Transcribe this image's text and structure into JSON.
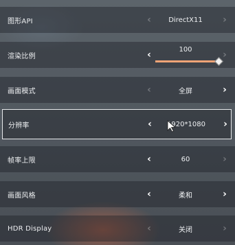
{
  "settings": [
    {
      "label": "图形API",
      "value": "DirectX11",
      "left_enabled": false,
      "right_enabled": false
    },
    {
      "label": "渲染比例",
      "value": "100",
      "left_enabled": true,
      "right_enabled": false,
      "slider_fraction": 1.0
    },
    {
      "label": "画面模式",
      "value": "全屏",
      "left_enabled": false,
      "right_enabled": true
    },
    {
      "label": "分辨率",
      "value": "1920*1080",
      "left_enabled": true,
      "right_enabled": true,
      "selected": true
    },
    {
      "label": "帧率上限",
      "value": "60",
      "left_enabled": true,
      "right_enabled": false
    },
    {
      "label": "画面风格",
      "value": "柔和",
      "left_enabled": true,
      "right_enabled": true
    },
    {
      "label": "HDR Display",
      "value": "关闭",
      "left_enabled": false,
      "right_enabled": false
    }
  ],
  "arrows": {
    "left": "‹",
    "right": "›"
  },
  "colors": {
    "slider_fill": "#f2a477",
    "selected_border": "#e8eaec"
  }
}
